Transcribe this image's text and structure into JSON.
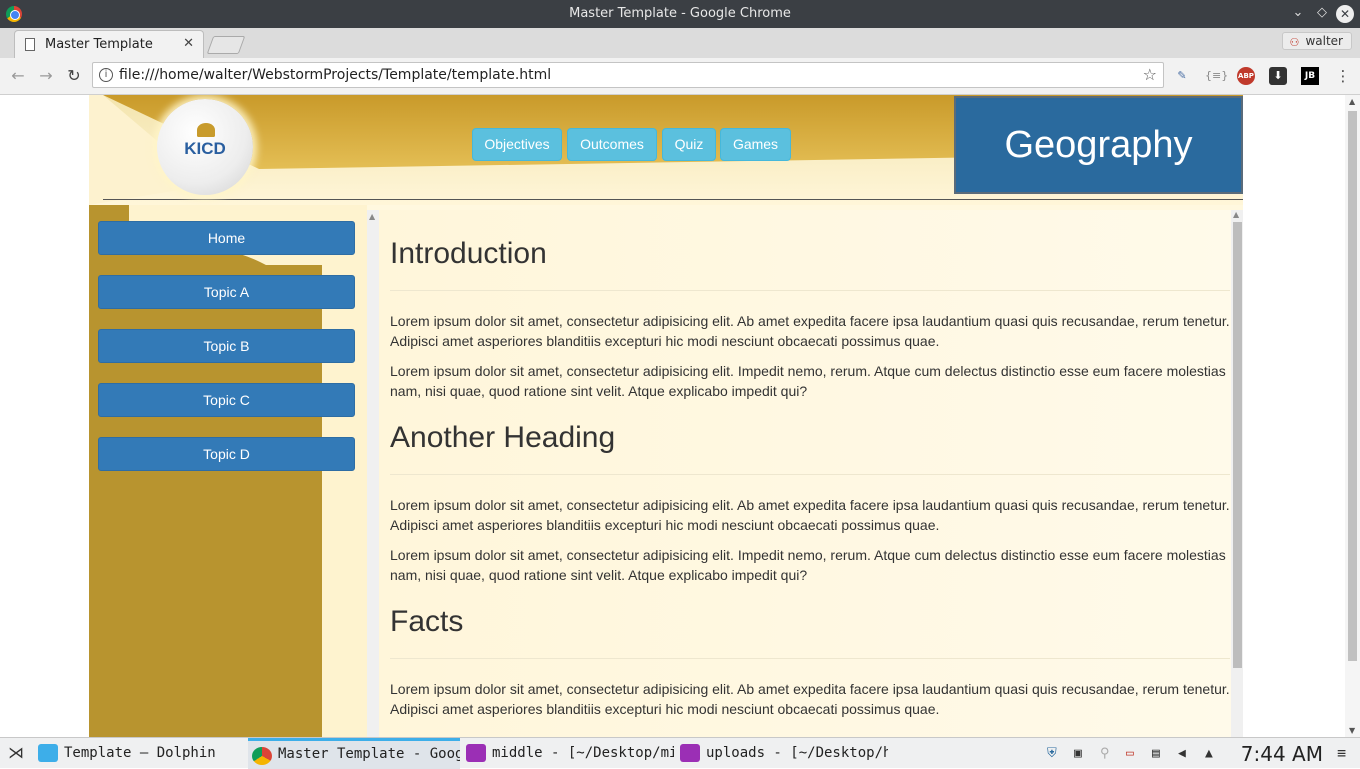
{
  "window": {
    "title": "Master Template - Google Chrome"
  },
  "browser": {
    "tab_title": "Master Template",
    "profile": "walter",
    "url": "file:///home/walter/WebstormProjects/Template/template.html"
  },
  "site": {
    "logo_text": "KICD",
    "subject": "Geography",
    "top_nav": [
      "Objectives",
      "Outcomes",
      "Quiz",
      "Games"
    ],
    "sidebar": [
      "Home",
      "Topic A",
      "Topic B",
      "Topic C",
      "Topic D"
    ],
    "sections": [
      {
        "heading": "Introduction",
        "paragraphs": [
          "Lorem ipsum dolor sit amet, consectetur adipisicing elit. Ab amet expedita facere ipsa laudantium quasi quis recusandae, rerum tenetur. Adipisci amet asperiores blanditiis excepturi hic modi nesciunt obcaecati possimus quae.",
          "Lorem ipsum dolor sit amet, consectetur adipisicing elit. Impedit nemo, rerum. Atque cum delectus distinctio esse eum facere molestias nam, nisi quae, quod ratione sint velit. Atque explicabo impedit qui?"
        ]
      },
      {
        "heading": "Another Heading",
        "paragraphs": [
          "Lorem ipsum dolor sit amet, consectetur adipisicing elit. Ab amet expedita facere ipsa laudantium quasi quis recusandae, rerum tenetur. Adipisci amet asperiores blanditiis excepturi hic modi nesciunt obcaecati possimus quae.",
          "Lorem ipsum dolor sit amet, consectetur adipisicing elit. Impedit nemo, rerum. Atque cum delectus distinctio esse eum facere molestias nam, nisi quae, quod ratione sint velit. Atque explicabo impedit qui?"
        ]
      },
      {
        "heading": "Facts",
        "paragraphs": [
          "Lorem ipsum dolor sit amet, consectetur adipisicing elit. Ab amet expedita facere ipsa laudantium quasi quis recusandae, rerum tenetur. Adipisci amet asperiores blanditiis excepturi hic modi nesciunt obcaecati possimus quae."
        ]
      }
    ]
  },
  "taskbar": {
    "tasks": [
      {
        "label": "Template — Dolphin",
        "icon": "folder-icon",
        "color": "#3daee9"
      },
      {
        "label": "Master Template - Goog…",
        "icon": "chrome-icon",
        "color": "#db4437"
      },
      {
        "label": "middle - [~/Desktop/mi…",
        "icon": "phpstorm-icon",
        "color": "#9b2fb5"
      },
      {
        "label": "uploads - [~/Desktop/h…",
        "icon": "phpstorm-icon",
        "color": "#9b2fb5"
      }
    ],
    "clock": "7:44 AM"
  },
  "colors": {
    "subject_bg": "#2a6a9e",
    "nav_button": "#5bc0de",
    "sidebar_button": "#337ab7",
    "sidebar_gold": "#b8942f"
  }
}
